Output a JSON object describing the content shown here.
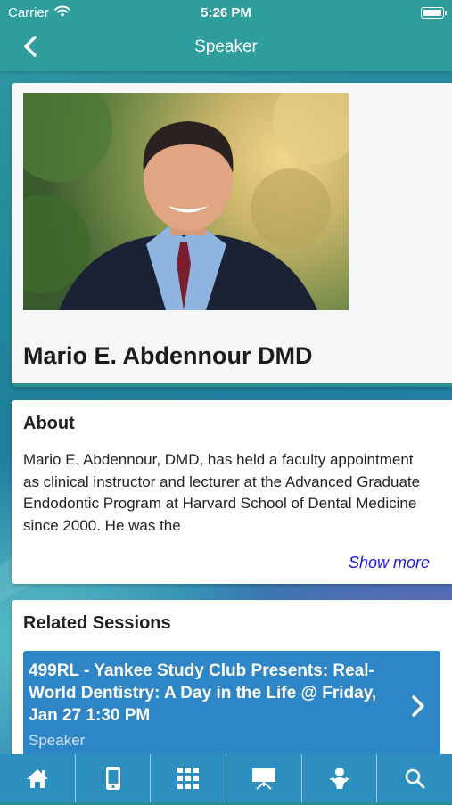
{
  "status_bar": {
    "carrier": "Carrier",
    "time": "5:26 PM"
  },
  "nav": {
    "title": "Speaker",
    "back_icon": "chevron-left-icon"
  },
  "speaker": {
    "name": "Mario E. Abdennour DMD"
  },
  "about": {
    "heading": "About",
    "text": "Mario E. Abdennour, DMD, has held a faculty appointment as clinical instructor and lecturer at the Advanced Graduate Endodontic Program at Harvard School of Dental Medicine since 2000. He was the",
    "show_more": "Show more"
  },
  "related": {
    "heading": "Related Sessions",
    "sessions": [
      {
        "title": "499RL - Yankee Study Club Presents: Real-World Dentistry: A Day in the Life @ Friday, Jan 27 1:30 PM",
        "role": "Speaker"
      }
    ]
  },
  "tabbar": {
    "items": [
      {
        "icon": "home-icon"
      },
      {
        "icon": "mobile-phone-icon"
      },
      {
        "icon": "grid-icon"
      },
      {
        "icon": "presentation-board-icon"
      },
      {
        "icon": "speaker-person-icon"
      },
      {
        "icon": "search-icon"
      }
    ]
  },
  "colors": {
    "header": "#2e9d9c",
    "tabbar": "#2c8fc0",
    "session_card": "#2f86c6",
    "link": "#1d1bd8"
  }
}
